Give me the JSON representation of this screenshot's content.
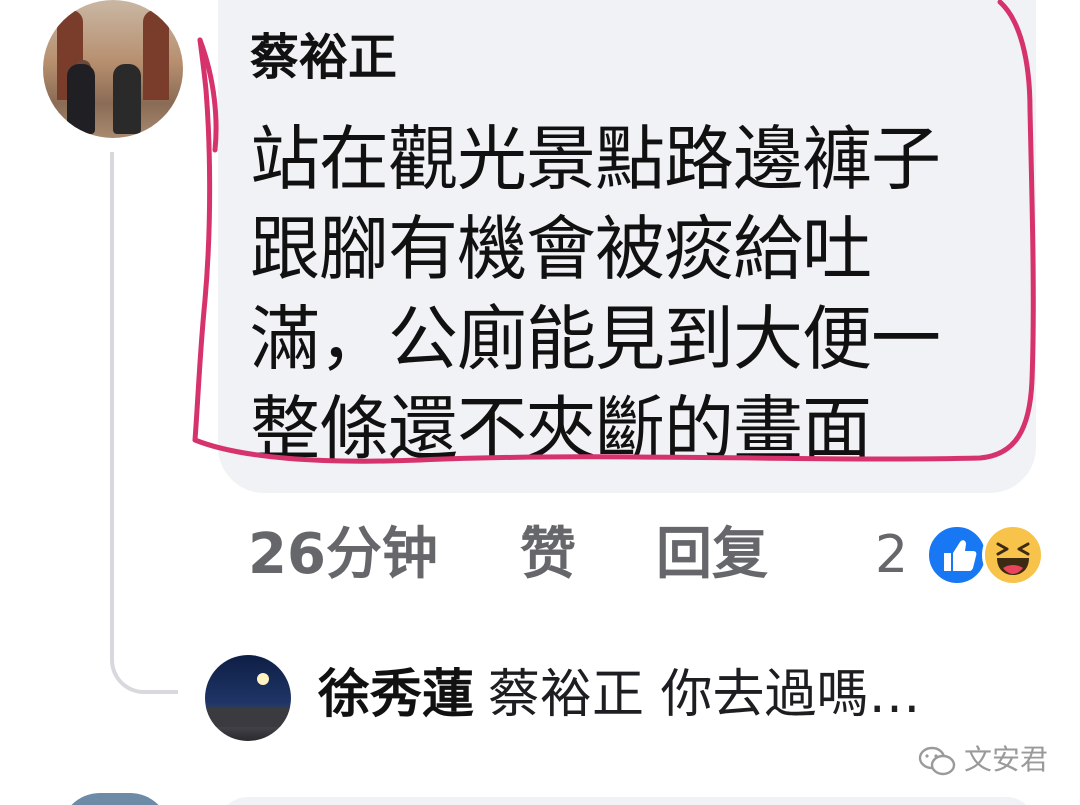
{
  "comment": {
    "author": "蔡裕正",
    "text_lines": [
      "站在觀光景點路邊褲子",
      "跟腳有機會被痰給吐",
      "滿，公廁能見到大便一",
      "整條還不夾斷的畫面"
    ],
    "time": "26分钟",
    "like_label": "赞",
    "reply_label": "回复",
    "reaction_count": "2",
    "reactions": [
      "like-icon",
      "haha-icon"
    ]
  },
  "reply": {
    "author": "徐秀蓮",
    "text": "蔡裕正 你去過嗎…"
  },
  "watermark": {
    "text": "文安君"
  },
  "colors": {
    "bubble": "#f0f2f5",
    "annotation": "#d6336c",
    "meta_text": "#65676b",
    "like_blue": "#1877f2",
    "haha_yellow": "#f7c34a"
  }
}
